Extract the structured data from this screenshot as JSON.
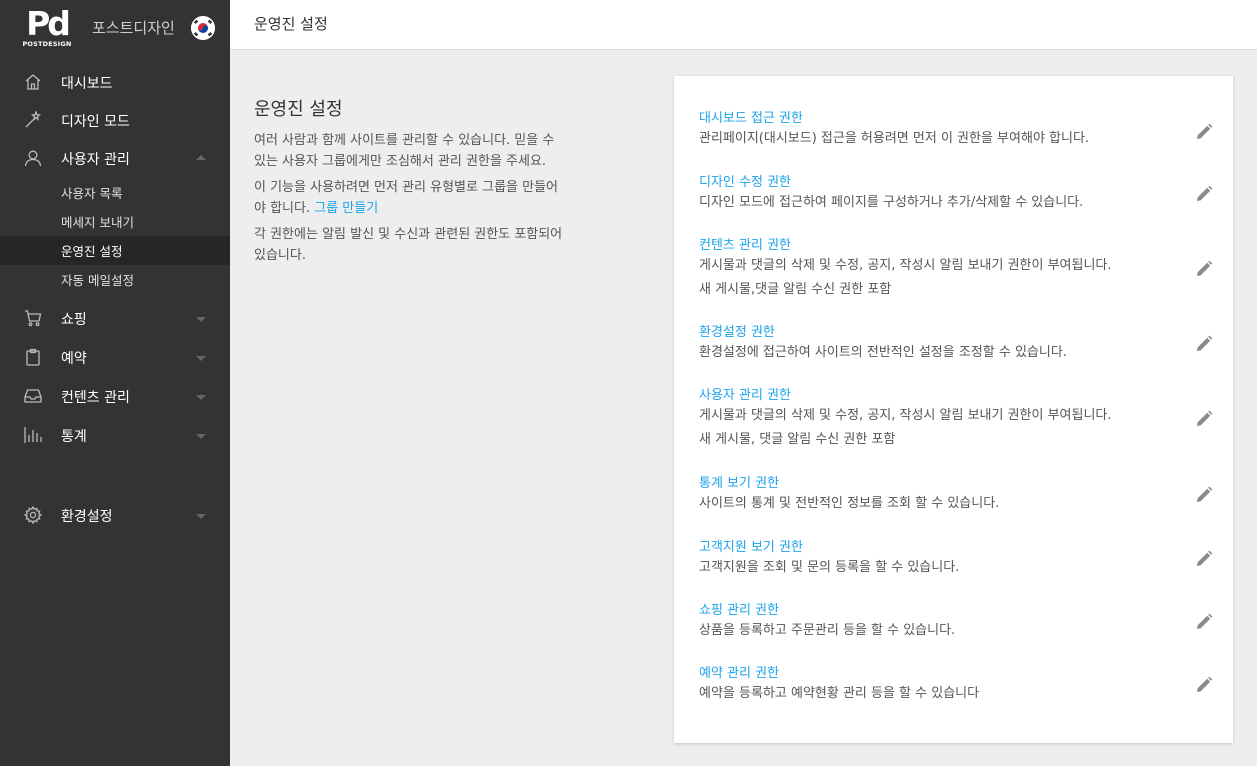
{
  "brand": {
    "logo_mark": "Pd",
    "logo_sub": "POSTDESIGN",
    "site_name": "포스트디자인"
  },
  "sidebar": {
    "items": [
      {
        "label": "대시보드",
        "icon": "home-icon"
      },
      {
        "label": "디자인 모드",
        "icon": "magic-wand-icon"
      },
      {
        "label": "사용자 관리",
        "icon": "user-icon",
        "expanded": true,
        "children": [
          {
            "label": "사용자 목록"
          },
          {
            "label": "메세지 보내기"
          },
          {
            "label": "운영진 설정",
            "active": true
          },
          {
            "label": "자동 메일설정"
          }
        ]
      },
      {
        "label": "쇼핑",
        "icon": "cart-icon"
      },
      {
        "label": "예약",
        "icon": "clipboard-icon"
      },
      {
        "label": "컨텐츠 관리",
        "icon": "inbox-icon"
      },
      {
        "label": "통계",
        "icon": "bar-chart-icon"
      },
      {
        "label": "환경설정",
        "icon": "gear-icon"
      }
    ]
  },
  "header": {
    "title": "운영진 설정"
  },
  "intro": {
    "title": "운영진 설정",
    "p1": "여러 사람과 함께 사이트를 관리할 수 있습니다. 믿을 수 있는 사용자 그룹에게만 조심해서 관리 권한을 주세요.",
    "p2": "이 기능을 사용하려면 먼저 관리 유형별로 그룹을 만들어야 합니다.",
    "p2_link": "그룹 만들기",
    "p3": "각 권한에는 알림 발신 및 수신과 관련된 권한도 포함되어 있습니다."
  },
  "permissions": [
    {
      "title": "대시보드 접근 권한",
      "desc": "관리페이지(대시보드) 접근을 허용려면 먼저 이 권한을 부여해야 합니다.",
      "desc2": ""
    },
    {
      "title": "디자인 수정 권한",
      "desc": "디자인 모드에 접근하여 페이지를 구성하거나 추가/삭제할 수 있습니다.",
      "desc2": ""
    },
    {
      "title": "컨텐츠 관리 권한",
      "desc": "게시물과 댓글의 삭제 및 수정, 공지, 작성시 알림 보내기 권한이 부여됩니다.",
      "desc2": "새 게시물,댓글 알림 수신 권한 포함"
    },
    {
      "title": "환경설정 권한",
      "desc": "환경설정에 접근하여 사이트의 전반적인 설정을 조정할 수 있습니다.",
      "desc2": ""
    },
    {
      "title": "사용자 관리 권한",
      "desc": "게시물과 댓글의 삭제 및 수정, 공지, 작성시 알림 보내기 권한이 부여됩니다.",
      "desc2": "새 게시물, 댓글 알림 수신 권한 포함"
    },
    {
      "title": "통계 보기 권한",
      "desc": "사이트의 통계 및 전반적인 정보를 조회 할 수 있습니다.",
      "desc2": ""
    },
    {
      "title": "고객지원 보기 권한",
      "desc": "고객지원을 조회 및 문의 등록을 할 수 있습니다.",
      "desc2": ""
    },
    {
      "title": "쇼핑 관리 권한",
      "desc": "상품을 등록하고 주문관리 등을 할 수 있습니다.",
      "desc2": ""
    },
    {
      "title": "예약 관리 권한",
      "desc": "예약을 등록하고 예약현황 관리 등을 할 수 있습니다",
      "desc2": ""
    }
  ],
  "colors": {
    "sidebar": "#333333",
    "sidebar_active": "#262626",
    "accent": "#1ca3ec",
    "background": "#eeeeee"
  }
}
